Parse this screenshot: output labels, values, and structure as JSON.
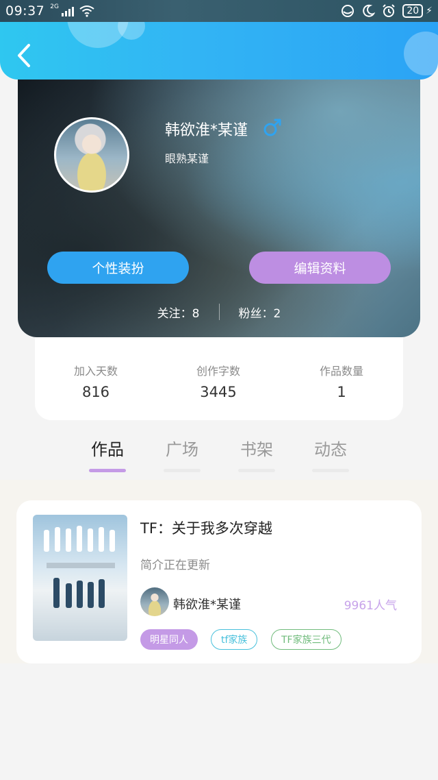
{
  "status_bar": {
    "time": "09:37",
    "network": "2G",
    "battery": "20"
  },
  "profile": {
    "username": "韩欲淮*某谨",
    "gender_symbol": "♂",
    "motto": "眼熟某谨",
    "dress_button": "个性装扮",
    "edit_button": "编辑资料",
    "following": "关注：8",
    "followers": "粉丝：2"
  },
  "stats": [
    {
      "label": "加入天数",
      "value": "816"
    },
    {
      "label": "创作字数",
      "value": "3445"
    },
    {
      "label": "作品数量",
      "value": "1"
    }
  ],
  "tabs": [
    {
      "label": "作品",
      "active": true
    },
    {
      "label": "广场",
      "active": false
    },
    {
      "label": "书架",
      "active": false
    },
    {
      "label": "动态",
      "active": false
    }
  ],
  "works": [
    {
      "title": "TF：关于我多次穿越",
      "description": "简介正在更新",
      "author": "韩欲淮*某谨",
      "popularity": "9961人气",
      "tags": [
        "明星同人",
        "tf家族",
        "TF家族三代"
      ]
    }
  ],
  "colors": {
    "header_blue": "#2fb4f2",
    "dress_button": "#2fa3f0",
    "edit_button": "#bd8ee2",
    "accent_purple": "#c49ae6",
    "tag_cyan": "#47c0db",
    "tag_green": "#6fbb7b"
  },
  "icons": [
    "back-icon",
    "male-gender-icon",
    "signal-icon",
    "wifi-icon",
    "moon-icon",
    "alarm-icon",
    "battery-icon"
  ]
}
